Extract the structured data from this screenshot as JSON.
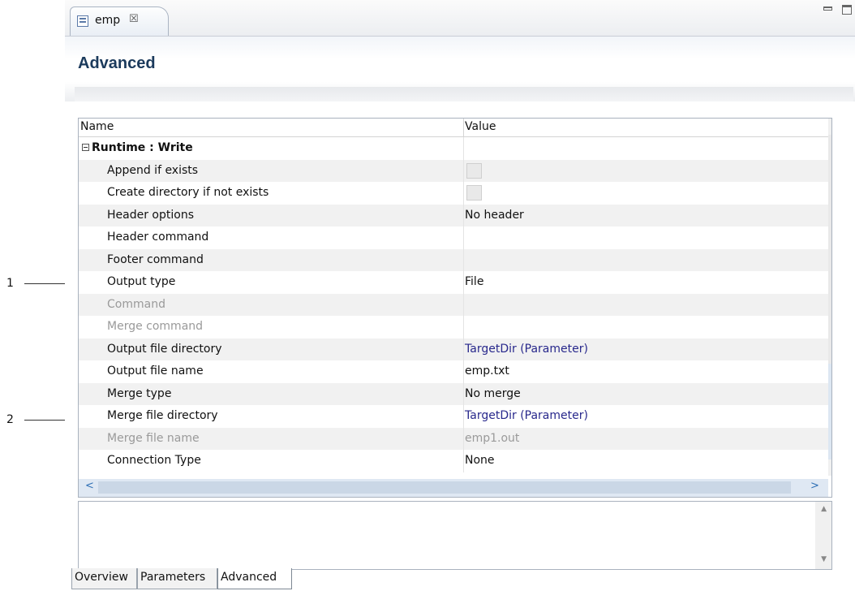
{
  "editor_tab": {
    "label": "emp",
    "close": "☒"
  },
  "page_title": "Advanced",
  "columns": {
    "name": "Name",
    "value": "Value"
  },
  "group": {
    "label": "Runtime : Write"
  },
  "rows": [
    {
      "name": "Append if exists",
      "value": "",
      "checkbox": true,
      "disabled": false
    },
    {
      "name": "Create directory if not exists",
      "value": "",
      "checkbox": true,
      "disabled": false
    },
    {
      "name": "Header options",
      "value": "No header",
      "disabled": false
    },
    {
      "name": "Header command",
      "value": "",
      "disabled": false
    },
    {
      "name": "Footer command",
      "value": "",
      "disabled": false
    },
    {
      "name": "Output type",
      "value": "File",
      "disabled": false
    },
    {
      "name": "Command",
      "value": "",
      "disabled": true
    },
    {
      "name": "Merge command",
      "value": "",
      "disabled": true
    },
    {
      "name": "Output file directory",
      "value": "TargetDir (Parameter)",
      "param": true,
      "disabled": false
    },
    {
      "name": "Output file name",
      "value": "emp.txt",
      "disabled": false
    },
    {
      "name": "Merge type",
      "value": "No merge",
      "disabled": false
    },
    {
      "name": "Merge file directory",
      "value": "TargetDir (Parameter)",
      "param": true,
      "disabled": false
    },
    {
      "name": "Merge file name",
      "value": "emp1.out",
      "disabled": true
    },
    {
      "name": "Connection Type",
      "value": "None",
      "disabled": false
    }
  ],
  "callouts": [
    {
      "label": "1"
    },
    {
      "label": "2"
    }
  ],
  "bottom_tabs": [
    {
      "label": "Overview"
    },
    {
      "label": "Parameters"
    },
    {
      "label": "Advanced"
    }
  ],
  "colors": {
    "title": "#1b3a5c",
    "param_link": "#28288c",
    "disabled_text": "#9a9a9a",
    "scroll_arrow": "#2e6fb5"
  }
}
